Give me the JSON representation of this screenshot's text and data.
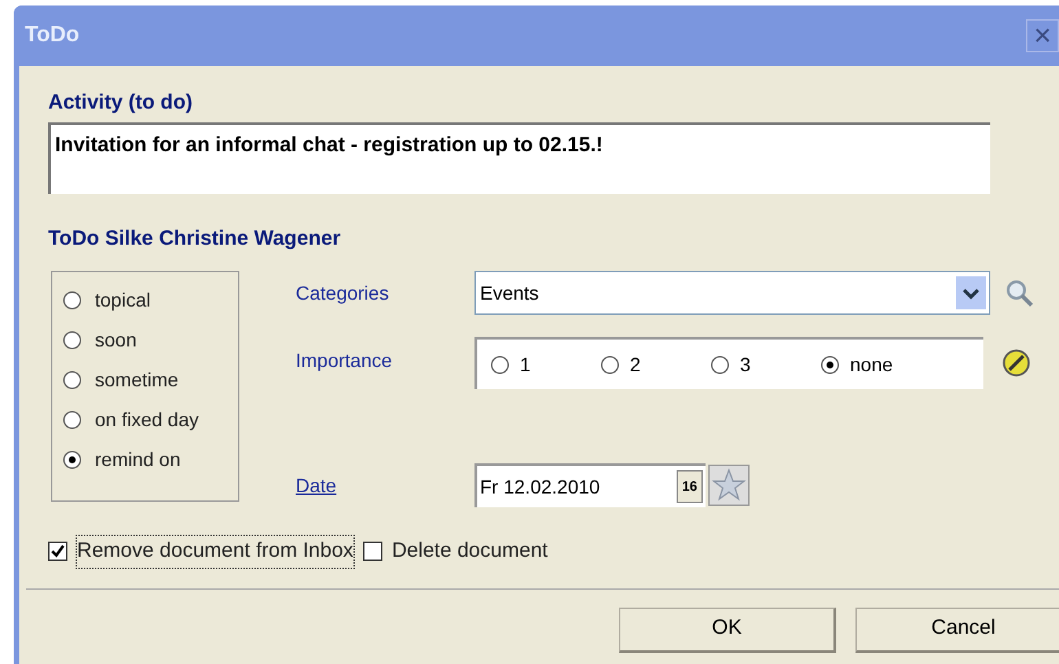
{
  "window": {
    "title": "ToDo",
    "close": "×"
  },
  "activity": {
    "label": "Activity (to do)",
    "value": "Invitation for an informal chat - registration up to 02.15.!"
  },
  "section_title": "ToDo Silke Christine Wagener",
  "timing": [
    {
      "label": "topical",
      "selected": false
    },
    {
      "label": "soon",
      "selected": false
    },
    {
      "label": "sometime",
      "selected": false
    },
    {
      "label": "on fixed day",
      "selected": false
    },
    {
      "label": "remind on",
      "selected": true
    }
  ],
  "categories": {
    "label": "Categories",
    "value": "Events"
  },
  "importance": {
    "label": "Importance",
    "options": [
      {
        "label": "1",
        "selected": false
      },
      {
        "label": "2",
        "selected": false
      },
      {
        "label": "3",
        "selected": false
      },
      {
        "label": "none",
        "selected": true
      }
    ]
  },
  "date": {
    "label": "Date",
    "value": "Fr 12.02.2010",
    "calendar": "16"
  },
  "checkboxes": [
    {
      "label": "Remove document from Inbox",
      "checked": true,
      "focused": true
    },
    {
      "label": "Delete document",
      "checked": false,
      "focused": false
    }
  ],
  "buttons": [
    "OK",
    "Cancel"
  ]
}
